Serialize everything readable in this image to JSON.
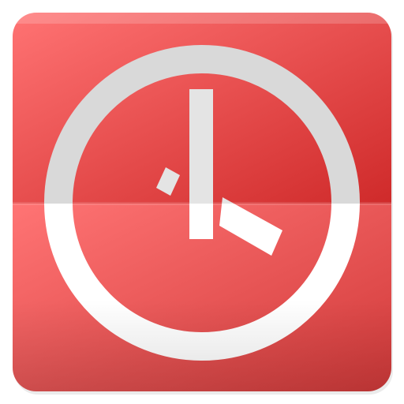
{
  "icon": {
    "name": "clock-icon",
    "colors": {
      "tile_top_light": "#ff7373",
      "tile_top_dark": "#cf2a2a",
      "tile_bottom_light": "#ff7474",
      "tile_bottom_dark": "#d23a3a",
      "ring_top": "#d9d9d9",
      "ring_bottom": "#ffffff",
      "hands_top": "#e4e4e4",
      "hands_bottom": "#ffffff"
    }
  }
}
